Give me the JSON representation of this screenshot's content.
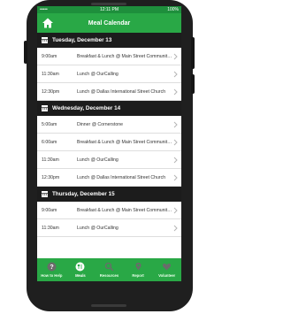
{
  "statusbar": {
    "carrier": "•••••",
    "time": "12:11 PM",
    "battery": "100%"
  },
  "appbar": {
    "title": "Meal Calendar"
  },
  "days": [
    {
      "label": "Tuesday, December 13",
      "meals": [
        {
          "time": "9:00am",
          "desc": "Breakfast & Lunch @ Main Street Community Center"
        },
        {
          "time": "11:30am",
          "desc": "Lunch @ OurCalling"
        },
        {
          "time": "12:30pm",
          "desc": "Lunch @ Dallas International Street Church"
        }
      ]
    },
    {
      "label": "Wednesday, December 14",
      "meals": [
        {
          "time": "5:00am",
          "desc": "Dinner @ Cornerstone"
        },
        {
          "time": "6:00am",
          "desc": "Breakfast & Lunch @ Main Street Community Center"
        },
        {
          "time": "11:30am",
          "desc": "Lunch @ OurCalling"
        },
        {
          "time": "12:30pm",
          "desc": "Lunch @ Dallas International Street Church"
        }
      ]
    },
    {
      "label": "Thursday, December 15",
      "meals": [
        {
          "time": "9:00am",
          "desc": "Breakfast & Lunch @ Main Street Community Center"
        },
        {
          "time": "11:30am",
          "desc": "Lunch @ OurCalling"
        }
      ]
    }
  ],
  "tabs": [
    {
      "label": "How to Help",
      "icon": "question-icon"
    },
    {
      "label": "Meals",
      "icon": "meals-icon"
    },
    {
      "label": "Resources",
      "icon": "magnifier-icon"
    },
    {
      "label": "Report",
      "icon": "report-pin-icon"
    },
    {
      "label": "Volunteer",
      "icon": "heart-icon"
    }
  ],
  "colors": {
    "header_green": "#29a846",
    "status_green": "#1e8f3c",
    "day_header": "#1c1c1c"
  }
}
